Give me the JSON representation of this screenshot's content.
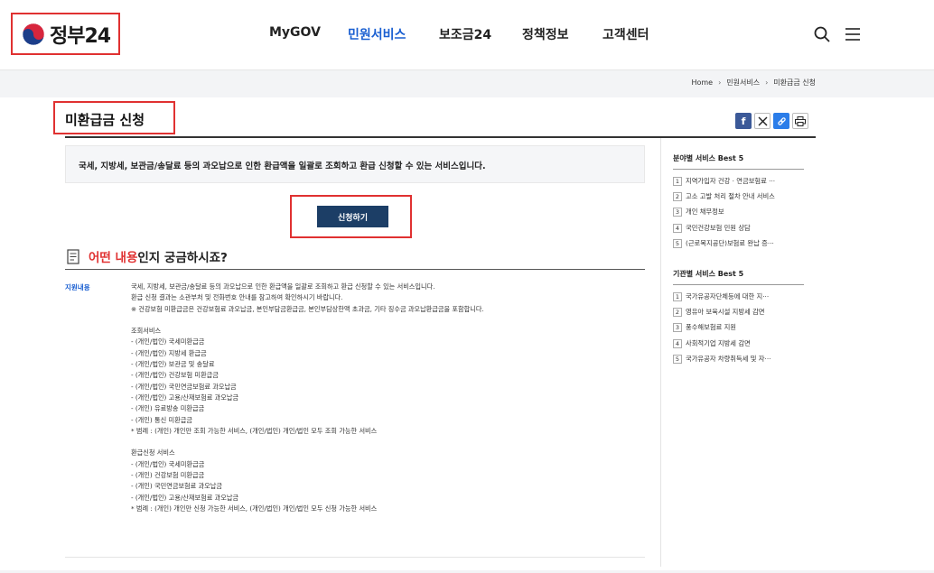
{
  "header": {
    "logo_text": "정부24",
    "nav": [
      {
        "label": "MyGOV",
        "active": false
      },
      {
        "label": "민원서비스",
        "active": true
      },
      {
        "label": "보조금24",
        "active": false
      },
      {
        "label": "정책정보",
        "active": false
      },
      {
        "label": "고객센터",
        "active": false
      }
    ],
    "search_icon": "search-icon",
    "menu_icon": "hamburger-menu-icon"
  },
  "breadcrumb": [
    "Home",
    "민원서비스",
    "미환급금 신청"
  ],
  "page": {
    "title": "미환급금 신청",
    "share_icons": [
      "facebook-icon",
      "x-icon",
      "link-icon",
      "print-icon"
    ],
    "summary": "국세, 지방세, 보관금/송달료 등의 과오납으로 인한 환급액을 일괄로 조회하고 환급 신청할 수 있는 서비스입니다.",
    "apply_button": "신청하기",
    "section_title_hl": "어떤 내용",
    "section_title_rest": "인지 궁금하시죠?",
    "detail_label": "지원내용",
    "detail_lines": [
      "국세, 지방세, 보관금/송달료 등의 과오납으로 인한 환급액을 일괄로 조회하고 환급 신청할 수 있는 서비스입니다.",
      "환급 신청 결과는 소관부처 및 전화번호 안내를 참고하여 확인하시기 바랍니다.",
      "※ 건강보험 미환급금은 건강보험료 과오납금, 본인부담금환급금, 본인부담상한액 초과금, 기타 징수금 과오납환급금을 포함합니다.",
      "",
      "조회서비스",
      "- (개인/법인) 국세미환급금",
      "- (개인/법인) 지방세 환급금",
      "- (개인/법인) 보관금 및 송달료",
      "- (개인/법인) 건강보험 미환급금",
      "- (개인/법인) 국민연금보험료 과오납금",
      "- (개인/법인) 고용/산재보험료 과오납금",
      "- (개인) 유료방송 미환급금",
      "- (개인) 통신 미환급금",
      "* 범례 : (개인) 개인만 조회 가능한 서비스, (개인/법인) 개인/법인 모두 조회 가능한 서비스",
      "",
      "환급신청 서비스",
      "- (개인/법인) 국세미환급금",
      "- (개인) 건강보험 미환급금",
      "- (개인) 국민연금보험료 과오납금",
      "- (개인/법인) 고용/산재보험료 과오납금",
      "* 범례 : (개인) 개인만 신청 가능한 서비스, (개인/법인) 개인/법인 모두 신청 가능한 서비스"
    ]
  },
  "sidebar": {
    "field_title": "분야별 서비스 Best 5",
    "field_items": [
      "지역가입자 건강 · 연금보험료 ···",
      "고소 고발 처리 절차 안내 서비스",
      "개인 채무정보",
      "국민건강보험 민원 상담",
      "(근로복지공단)보험료 완납 증···"
    ],
    "org_title": "기관별 서비스 Best 5",
    "org_items": [
      "국가유공자단체등에 대한 지···",
      "영유아 보육시설 지방세 감면",
      "풍수해보험료 지원",
      "사회적기업 지방세 감면",
      "국가유공자 차량취득세 및 자···"
    ]
  },
  "colors": {
    "accent_blue": "#1a5fd1",
    "button_navy": "#1c3e66",
    "highlight_red": "#e03131"
  }
}
